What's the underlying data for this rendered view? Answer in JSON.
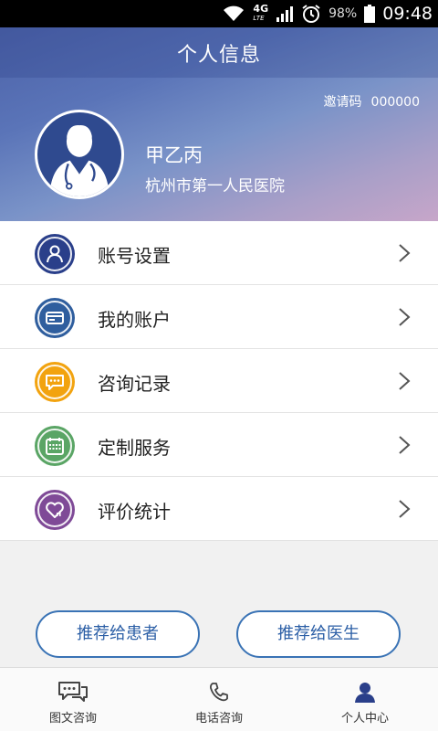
{
  "status_bar": {
    "network": "4G",
    "network_sub": "LTE",
    "battery": "98%",
    "time": "09:48"
  },
  "header": {
    "title": "个人信息",
    "invite_label": "邀请码",
    "invite_code": "000000",
    "name": "甲乙丙",
    "hospital": "杭州市第一人民医院"
  },
  "menu": [
    {
      "label": "账号设置",
      "icon": "user-icon",
      "color": "#2a3f8a"
    },
    {
      "label": "我的账户",
      "icon": "card-icon",
      "color": "#2f5e9e"
    },
    {
      "label": "咨询记录",
      "icon": "chat-record-icon",
      "color": "#f2a30f"
    },
    {
      "label": "定制服务",
      "icon": "calendar-icon",
      "color": "#5aa565"
    },
    {
      "label": "评价统计",
      "icon": "heart-stats-icon",
      "color": "#7f4a97"
    }
  ],
  "buttons": {
    "recommend_patient": "推荐给患者",
    "recommend_doctor": "推荐给医生"
  },
  "tabs": [
    {
      "label": "图文咨询",
      "icon": "chat-icon",
      "active": false
    },
    {
      "label": "电话咨询",
      "icon": "phone-icon",
      "active": false
    },
    {
      "label": "个人中心",
      "icon": "person-icon",
      "active": true
    }
  ],
  "colors": {
    "accent": "#3a73b5",
    "tab_active": "#2a3f8a"
  }
}
